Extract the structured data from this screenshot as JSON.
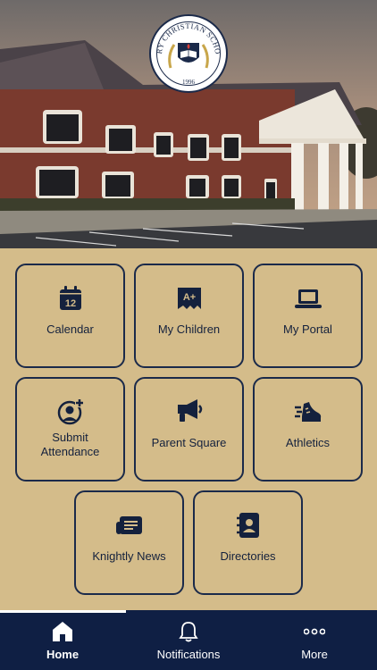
{
  "school": {
    "logo_name": "CARY CHRISTIAN SCHOOL",
    "logo_year": "1996"
  },
  "tiles": [
    {
      "label": "Calendar",
      "icon": "calendar-icon",
      "day": "12"
    },
    {
      "label": "My Children",
      "icon": "grade-a-plus-icon",
      "badge": "A+"
    },
    {
      "label": "My Portal",
      "icon": "laptop-icon"
    },
    {
      "label": "Submit Attendance",
      "icon": "user-add-icon"
    },
    {
      "label": "Parent Square",
      "icon": "megaphone-icon"
    },
    {
      "label": "Athletics",
      "icon": "running-shoe-icon"
    },
    {
      "label": "Knightly News",
      "icon": "newspaper-icon"
    },
    {
      "label": "Directories",
      "icon": "address-book-icon"
    }
  ],
  "nav": {
    "items": [
      {
        "label": "Home",
        "icon": "home-icon",
        "active": true
      },
      {
        "label": "Notifications",
        "icon": "bell-icon"
      },
      {
        "label": "More",
        "icon": "more-dots-icon"
      }
    ]
  },
  "colors": {
    "background": "#d4bc8a",
    "navy": "#0f1f44",
    "tile_border": "#1b2a4a"
  }
}
